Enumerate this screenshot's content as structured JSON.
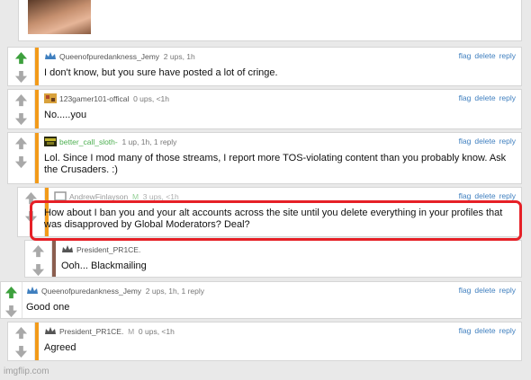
{
  "accent_colors": {
    "stripe_orange": "#f29b1a",
    "stripe_brown": "#8b5e4f",
    "vote_up_active": "#3da03d",
    "vote_inactive": "#a9a9a9",
    "mark_red": "#e62027",
    "link_blue": "#3f7fbf",
    "mod_green": "#4caf50"
  },
  "actions": {
    "flag": "flag",
    "delete": "delete",
    "reply": "reply"
  },
  "comments": [
    {
      "user": "Queenofpuredankness_Jemy",
      "meta": "2 ups, 1h",
      "text": "I don't know, but you sure have posted a lot of cringe.",
      "avatar": "crown-icon",
      "upvoted": true
    },
    {
      "user": "123gamer101-offical",
      "meta": "0 ups, <1h",
      "text": "No.....you",
      "avatar": "user-avatar-icon",
      "upvoted": false
    },
    {
      "user": "better_call_sloth-",
      "meta": "1 up, 1h, 1 reply",
      "text": "Lol. Since I mod many of those streams, I report more TOS-violating content than you probably know. Ask the Crusaders. :)",
      "avatar": "user-avatar-icon",
      "upvoted": false
    },
    {
      "user": "AndrewFinlayson",
      "mod": "M",
      "meta": "3 ups, <1h",
      "text": "How about I ban you and your alt accounts across the site until you delete everything in your profiles that was disapproved by Global Moderators? Deal?",
      "avatar": "user-avatar-icon",
      "upvoted": false
    },
    {
      "user": "President_PR1CE.",
      "meta": "",
      "text": "Ooh... Blackmailing",
      "avatar": "crown-icon",
      "upvoted": false
    },
    {
      "user": "Queenofpuredankness_Jemy",
      "meta": "2 ups, 1h, 1 reply",
      "text": "Good one",
      "avatar": "crown-icon",
      "upvoted": true
    },
    {
      "user": "President_PR1CE.",
      "mod": "M",
      "meta": "0 ups, <1h",
      "text": "Agreed",
      "avatar": "crown-icon",
      "upvoted": false
    }
  ],
  "watermark": "imgflip.com"
}
